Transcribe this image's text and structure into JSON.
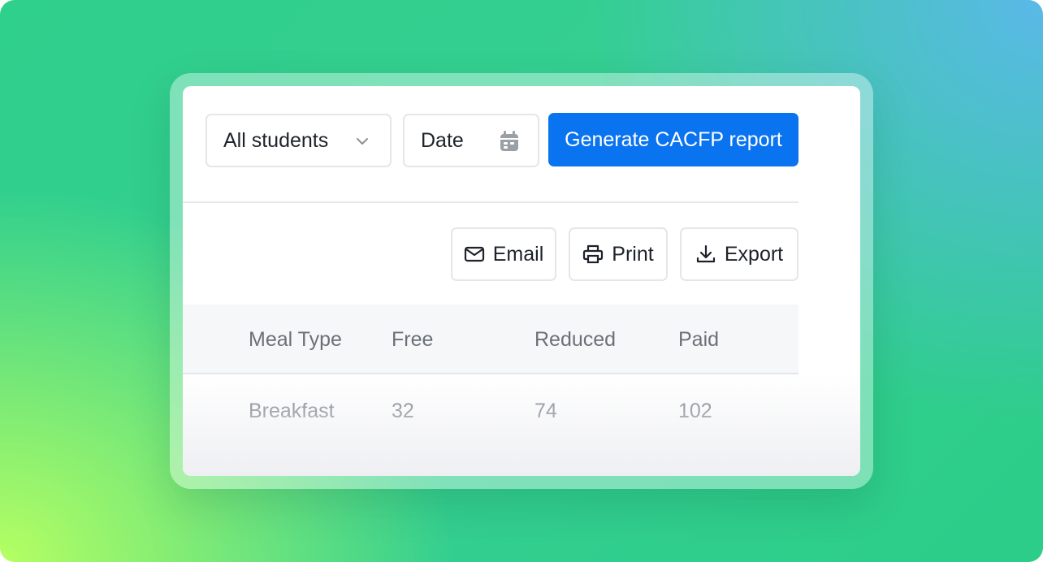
{
  "toolbar": {
    "student_filter": {
      "selected": "All students",
      "icon": "chevron-down-icon"
    },
    "date_picker": {
      "label": "Date",
      "icon": "calendar-icon"
    },
    "generate_label": "Generate CACFP report"
  },
  "actions": {
    "email": {
      "label": "Email",
      "icon": "mail-icon"
    },
    "print": {
      "label": "Print",
      "icon": "printer-icon"
    },
    "export": {
      "label": "Export",
      "icon": "download-icon"
    }
  },
  "table": {
    "columns": [
      "Meal Type",
      "Free",
      "Reduced",
      "Paid"
    ],
    "rows": [
      {
        "meal_type": "Breakfast",
        "free": "32",
        "reduced": "74",
        "paid": "102"
      }
    ]
  },
  "colors": {
    "primary": "#0a73f0",
    "background_green": "#2fcf8c",
    "background_blue": "#5ab9e8",
    "background_lime": "#b5ff62"
  }
}
